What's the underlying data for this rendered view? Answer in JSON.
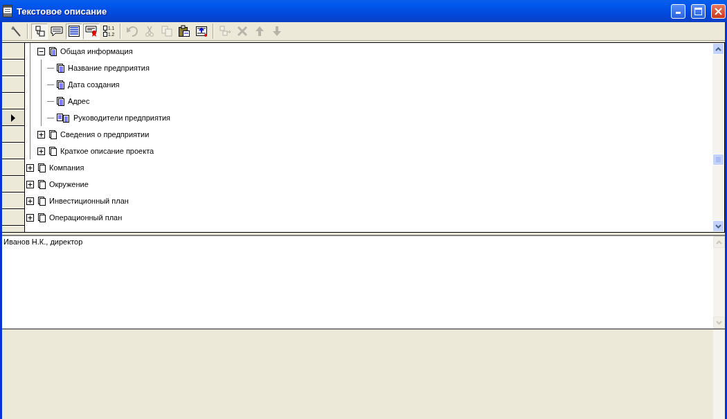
{
  "window": {
    "title": "Текстовое описание"
  },
  "toolbar": [
    {
      "kind": "wrench",
      "pressed": false,
      "disabled": false
    },
    {
      "kind": "separator"
    },
    {
      "kind": "tree",
      "pressed": true,
      "disabled": false
    },
    {
      "kind": "comment",
      "pressed": false,
      "disabled": false
    },
    {
      "kind": "text",
      "pressed": true,
      "disabled": false
    },
    {
      "kind": "seal",
      "pressed": true,
      "disabled": false
    },
    {
      "kind": "numbering",
      "pressed": false,
      "disabled": false,
      "labels": [
        "1.1",
        "1.2"
      ]
    },
    {
      "kind": "separator"
    },
    {
      "kind": "undo",
      "pressed": false,
      "disabled": true
    },
    {
      "kind": "cut",
      "pressed": false,
      "disabled": true
    },
    {
      "kind": "copy",
      "pressed": false,
      "disabled": true
    },
    {
      "kind": "paste",
      "pressed": false,
      "disabled": false
    },
    {
      "kind": "import",
      "pressed": false,
      "disabled": false
    },
    {
      "kind": "separator"
    },
    {
      "kind": "move",
      "pressed": false,
      "disabled": true
    },
    {
      "kind": "delete",
      "pressed": false,
      "disabled": true
    },
    {
      "kind": "up",
      "pressed": false,
      "disabled": true
    },
    {
      "kind": "down",
      "pressed": false,
      "disabled": true
    }
  ],
  "tree": {
    "items": [
      {
        "children": [
          {
            "label": "Общая информация",
            "kind": "page",
            "expanded": true,
            "current": false,
            "children": [
              {
                "label": "Название предприятия",
                "kind": "page",
                "current": false
              },
              {
                "label": "Дата создания",
                "kind": "page",
                "current": false
              },
              {
                "label": "Адрес",
                "kind": "page",
                "current": false
              },
              {
                "label": "Руководители предприятия",
                "kind": "pages",
                "current": true
              }
            ]
          },
          {
            "label": "Сведения о предприятии",
            "kind": "section",
            "expanded": false,
            "current": false
          },
          {
            "label": "Краткое описание проекта",
            "kind": "section",
            "expanded": false,
            "current": false
          }
        ]
      },
      {
        "label": "Компания",
        "kind": "section",
        "expanded": false,
        "current": false
      },
      {
        "label": "Окружение",
        "kind": "section",
        "expanded": false,
        "current": false
      },
      {
        "label": "Инвестиционный план",
        "kind": "section",
        "expanded": false,
        "current": false
      },
      {
        "label": "Операционный план",
        "kind": "section",
        "expanded": false,
        "current": false
      }
    ]
  },
  "text_pane": {
    "value": "Иванов Н.К., директор"
  }
}
